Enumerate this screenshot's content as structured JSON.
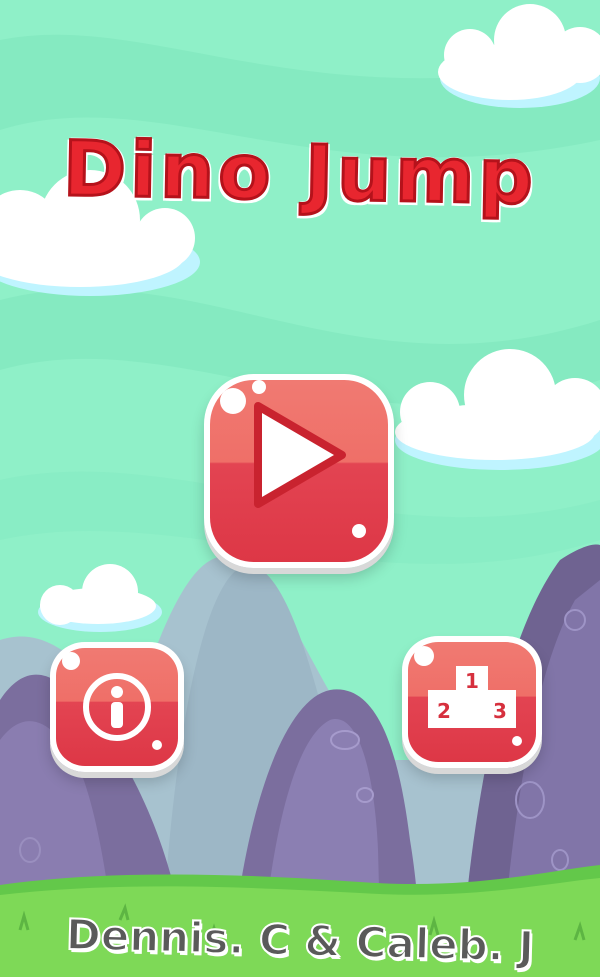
{
  "game": {
    "title": "Dino Jump",
    "credits": "Dennis. C & Caleb. J"
  },
  "buttons": {
    "play": {
      "icon": "play-icon"
    },
    "info": {
      "icon": "info-icon"
    },
    "leaderboard": {
      "icon": "podium-icon",
      "podium": [
        "1",
        "2",
        "3"
      ]
    }
  },
  "colors": {
    "sky": "#8ff0c8",
    "title_red": "#e8262f",
    "button_red": "#e34452",
    "grass": "#7ed957",
    "rocks": "#7a6e9c"
  }
}
